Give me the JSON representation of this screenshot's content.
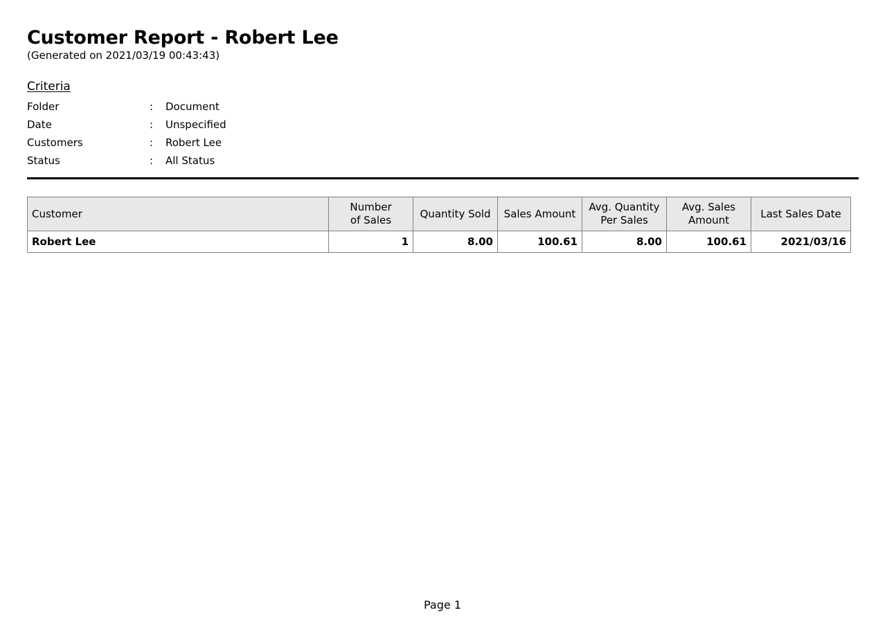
{
  "report": {
    "title": "Customer Report - Robert Lee",
    "generated": "(Generated on 2021/03/19 00:43:43)"
  },
  "criteria": {
    "heading": "Criteria",
    "separator": ":",
    "rows": [
      {
        "label": "Folder",
        "value": "Document"
      },
      {
        "label": "Date",
        "value": "Unspecified"
      },
      {
        "label": "Customers",
        "value": "Robert Lee"
      },
      {
        "label": "Status",
        "value": "All Status"
      }
    ]
  },
  "table": {
    "columns": [
      {
        "line1": "Customer",
        "line2": ""
      },
      {
        "line1": "Number",
        "line2": "of Sales"
      },
      {
        "line1": "Quantity Sold",
        "line2": ""
      },
      {
        "line1": "Sales Amount",
        "line2": ""
      },
      {
        "line1": "Avg. Quantity",
        "line2": "Per Sales"
      },
      {
        "line1": "Avg. Sales",
        "line2": "Amount"
      },
      {
        "line1": "Last Sales Date",
        "line2": ""
      }
    ],
    "rows": [
      {
        "customer": "Robert Lee",
        "number_of_sales": "1",
        "quantity_sold": "8.00",
        "sales_amount": "100.61",
        "avg_quantity_per_sales": "8.00",
        "avg_sales_amount": "100.61",
        "last_sales_date": "2021/03/16"
      }
    ]
  },
  "footer": {
    "page_label": "Page 1"
  },
  "colors": {
    "header_background": "#e8e8e8",
    "border": "#808080",
    "rule": "#000000",
    "text": "#000000",
    "page_background": "#ffffff"
  }
}
